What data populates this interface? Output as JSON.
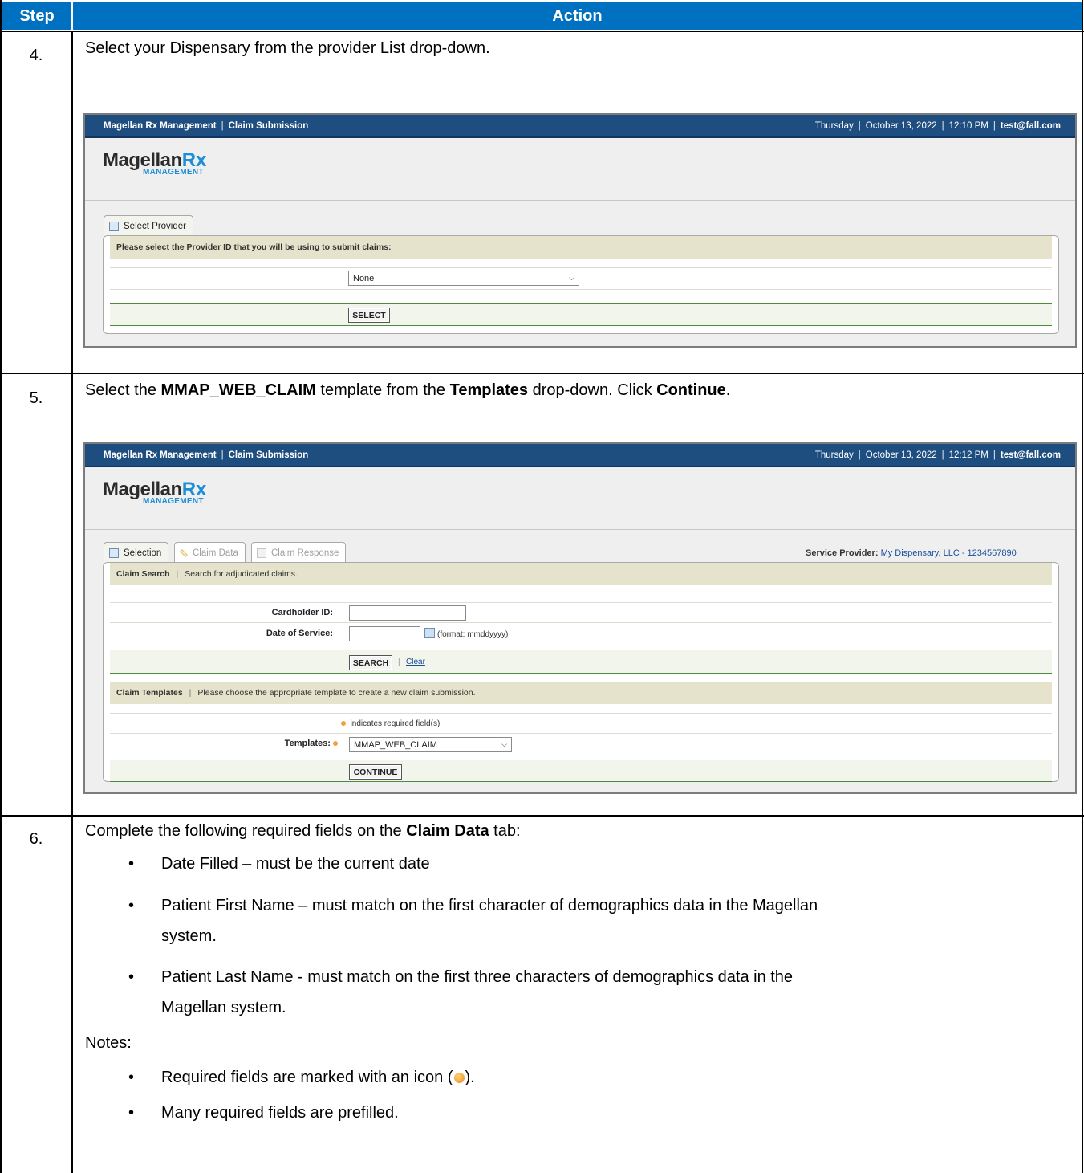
{
  "table": {
    "header_step": "Step",
    "header_action": "Action"
  },
  "step4": {
    "num": "4.",
    "text": "Select your Dispensary from the provider List drop-down.",
    "shot": {
      "app_title": "Magellan Rx Management",
      "app_section": "Claim Submission",
      "day": "Thursday",
      "date": "October 13, 2022",
      "time": "12:10 PM",
      "user": "test@fall.com",
      "logo_main": "Magellan",
      "logo_rx": "Rx",
      "logo_sub": "MANAGEMENT",
      "tab_label": "Select Provider",
      "prompt": "Please select the Provider ID that you will be using to submit claims:",
      "provider_select": "None",
      "select_button": "SELECT"
    }
  },
  "step5": {
    "num": "5.",
    "text_pre": "Select the ",
    "text_bold1": "MMAP_WEB_CLAIM",
    "text_mid": " template from the ",
    "text_bold2": "Templates",
    "text_mid2": " drop-down. Click ",
    "text_bold3": "Continue",
    "text_post": ".",
    "shot": {
      "app_title": "Magellan Rx Management",
      "app_section": "Claim Submission",
      "day": "Thursday",
      "date": "October 13, 2022",
      "time": "12:12 PM",
      "user": "test@fall.com",
      "logo_main": "Magellan",
      "logo_rx": "Rx",
      "logo_sub": "MANAGEMENT",
      "tabs": [
        "Selection",
        "Claim Data",
        "Claim Response"
      ],
      "service_provider_label": "Service Provider:",
      "service_provider_value": "My Dispensary, LLC - 1234567890",
      "claim_search_title": "Claim Search",
      "claim_search_desc": "Search for adjudicated claims.",
      "cardholder_label": "Cardholder ID:",
      "dos_label": "Date of Service:",
      "dos_format": "(format: mmddyyyy)",
      "search_button": "SEARCH",
      "clear_link": "Clear",
      "templates_title": "Claim Templates",
      "templates_desc": "Please choose the appropriate template to create a new claim submission.",
      "required_note": "indicates required field(s)",
      "templates_label": "Templates:",
      "templates_value": "MMAP_WEB_CLAIM",
      "continue_button": "CONTINUE"
    }
  },
  "step6": {
    "num": "6.",
    "text_pre": "Complete the following required fields on the ",
    "text_bold": "Claim Data",
    "text_post": " tab:",
    "bullets": [
      "Date Filled – must be the current date",
      "Patient First Name – must match on the first character of demographics data in the Magellan",
      "system.",
      "Patient Last Name - must match on the first three characters of demographics data in the",
      "Magellan system."
    ],
    "notes_label": "Notes:",
    "notes": [
      "Required fields are marked with an icon (",
      ").",
      "Many required fields are prefilled."
    ]
  }
}
